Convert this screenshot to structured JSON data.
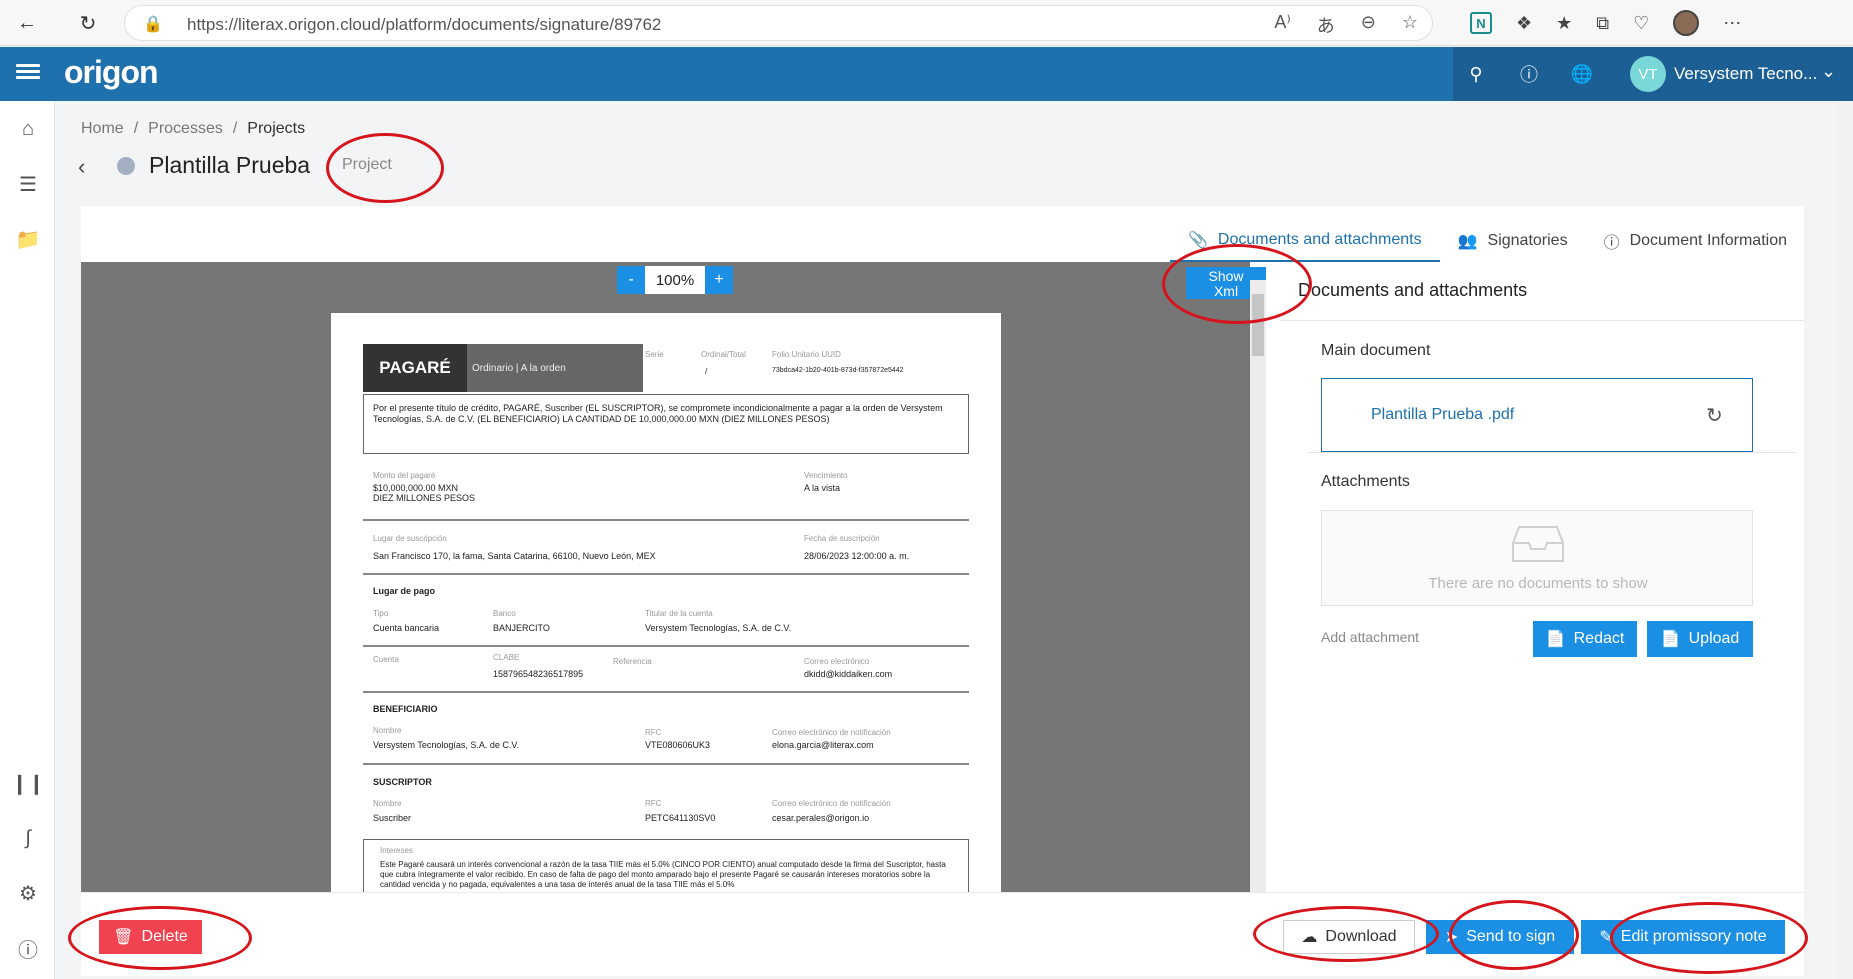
{
  "browser": {
    "url": "https://literax.origon.cloud/platform/documents/signature/89762",
    "back_icon": "arrow-left-icon",
    "reload_icon": "reload-icon"
  },
  "header": {
    "logo": "origon",
    "avatar_initials": "VT",
    "user_name": "Versystem Tecno...",
    "accent": "#1f71ad"
  },
  "breadcrumb": {
    "items": [
      "Home",
      "Processes",
      "Projects"
    ],
    "separator": "/"
  },
  "page": {
    "title": "Plantilla Prueba",
    "status": "Project"
  },
  "tabs": [
    {
      "label": "Documents and attachments",
      "active": true
    },
    {
      "label": "Signatories",
      "active": false
    },
    {
      "label": "Document Information",
      "active": false
    }
  ],
  "viewer": {
    "zoom_out": "-",
    "zoom": "100%",
    "zoom_in": "+",
    "show_xml": [
      "Show",
      "Xml"
    ]
  },
  "pdf": {
    "title": "PAGARÉ",
    "subtitle": "Ordinario | A la orden",
    "hdr_labels": [
      "Serie",
      "Ordinal/Total",
      "Folio Unitario UUID"
    ],
    "ordinal": "/",
    "uuid": "73bdca42-1b20-401b-873d-f357872e5442",
    "intro": "Por el presente título de crédito, PAGARÉ, Suscriber (EL SUSCRIPTOR), se compromete incondicionalmente a pagar a la orden de Versystem Tecnologías, S.A. de C.V. (EL BENEFICIARIO) LA CANTIDAD DE 10,000,000.00 MXN (DIEZ MILLONES PESOS)",
    "monto_label": "Monto del pagaré",
    "monto": "$10,000,000.00 MXN",
    "monto_words": "DIEZ MILLONES PESOS",
    "venc_label": "Vencimiento",
    "venc": "A la vista",
    "lugar_sus_label": "Lugar de suscripción",
    "lugar_sus": "San Francisco 170, la fama, Santa Catarina, 66100, Nuevo León, MEX",
    "fecha_sus_label": "Fecha de suscripción",
    "fecha_sus": "28/06/2023 12:00:00 a. m.",
    "lugar_pago": "Lugar de pago",
    "tipo_label": "Tipo",
    "tipo": "Cuenta bancaria",
    "banco_label": "Banco",
    "banco": "BANJERCITO",
    "titular_label": "Titular de la cuenta",
    "titular": "Versystem Tecnologías, S.A. de C.V.",
    "cuenta_label": "Cuenta",
    "clabe_label": "CLABE",
    "clabe": "158796548236517895",
    "ref_label": "Referencia",
    "correo_label": "Correo electrónico",
    "correo": "dkidd@kiddaiken.com",
    "benef": "BENEFICIARIO",
    "nombre_label": "Nombre",
    "benef_nombre": "Versystem Tecnologías, S.A. de C.V.",
    "rfc_label": "RFC",
    "benef_rfc": "VTE080606UK3",
    "notif_label": "Correo electrónico de notificación",
    "benef_email": "elona.garcia@literax.com",
    "suscriptor": "SUSCRIPTOR",
    "sus_nombre": "Suscriber",
    "sus_rfc": "PETC641130SV0",
    "sus_email": "cesar.perales@origon.io",
    "intereses_label": "Intereses",
    "intereses": "Este Pagaré causará un interés convencional a razón de la tasa TIIE más el 5.0% (CINCO POR CIENTO) anual computado desde la firma del Suscriptor, hasta que cubra íntegramente el valor recibido. En caso de falta de pago del monto amparado bajo el presente Pagaré se causarán intereses moratorios sobre la cantidad vencida y no pagada, equivalentes a una tasa de interés anual de la tasa TIIE más el 5.0%"
  },
  "right_panel": {
    "title": "Documents and attachments",
    "main_doc_label": "Main document",
    "main_doc_name": "Plantilla Prueba .pdf",
    "attachments_label": "Attachments",
    "empty_text": "There are no documents to show",
    "add_attachment": "Add attachment",
    "redact": "Redact",
    "upload": "Upload"
  },
  "footer": {
    "delete": "Delete",
    "download": "Download",
    "send_to_sign": "Send to sign",
    "edit_note": "Edit promissory note"
  },
  "colors": {
    "primary": "#1a8fe3",
    "danger": "#f0424f",
    "annotation": "#d5141b"
  }
}
